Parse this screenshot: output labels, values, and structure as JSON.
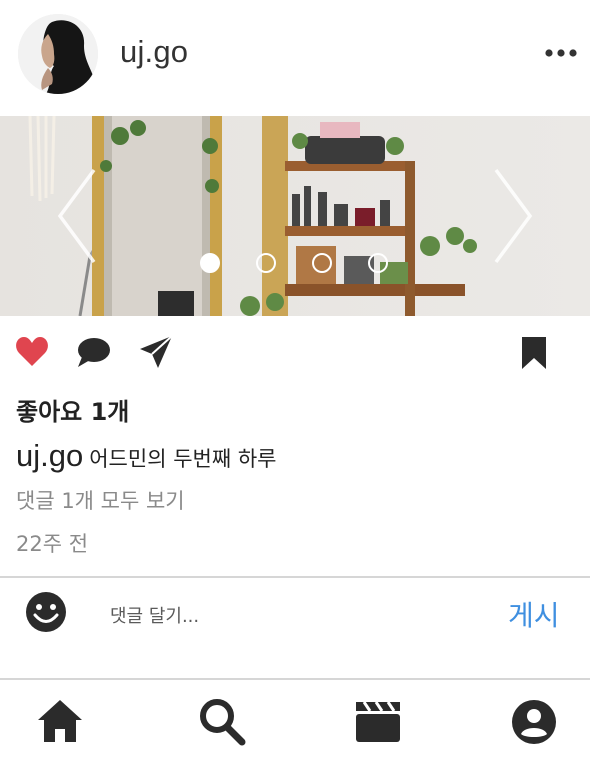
{
  "header": {
    "username": "uj.go",
    "avatar_icon": "profile-photo",
    "more_icon": "more-dots-icon"
  },
  "carousel": {
    "slide_count": 4,
    "active_index": 0,
    "prev_icon": "chevron-left-icon",
    "next_icon": "chevron-right-icon"
  },
  "actions": {
    "like_icon": "heart-icon",
    "like_color": "#e0454f",
    "comment_icon": "comment-icon",
    "share_icon": "send-icon",
    "save_icon": "bookmark-icon"
  },
  "post": {
    "likes": "좋아요 1개",
    "caption_user": "uj.go",
    "caption_text": "어드민의 두번째 하루",
    "view_comments": "댓글 1개 모두 보기",
    "timestamp": "22주 전"
  },
  "comment_bar": {
    "emoji_icon": "smiley-icon",
    "placeholder": "댓글 달기...",
    "post_label": "게시",
    "post_color": "#3f8fe0"
  },
  "bottom_nav": {
    "items": [
      "home-icon",
      "search-icon",
      "reels-icon",
      "profile-icon"
    ]
  }
}
